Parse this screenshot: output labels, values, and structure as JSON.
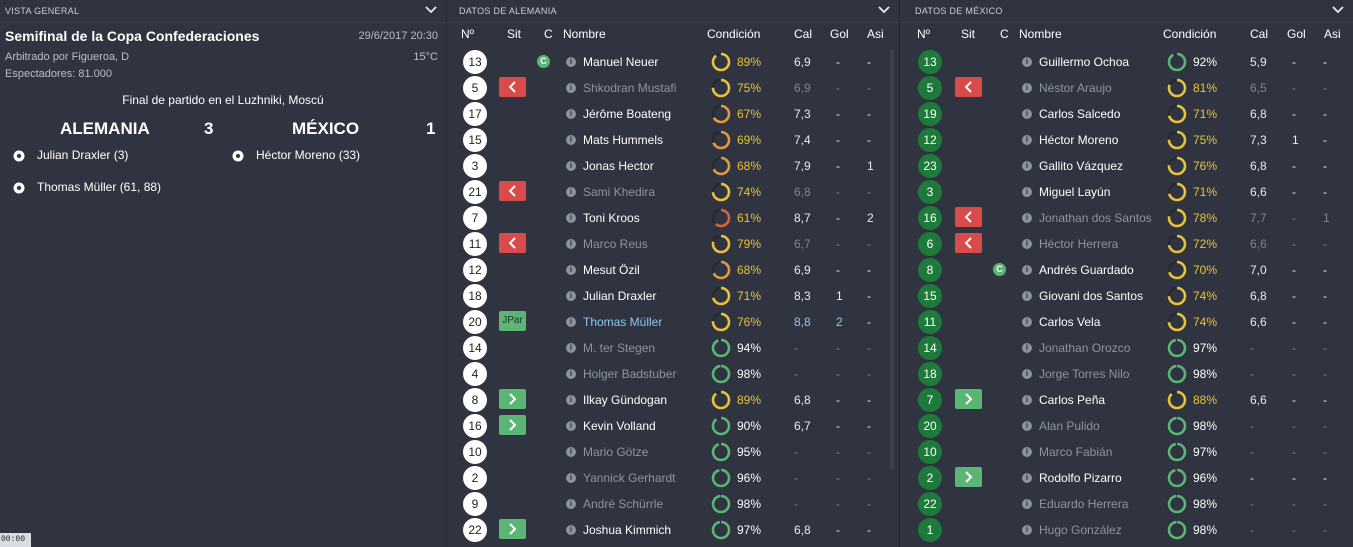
{
  "overview": {
    "header": "VISTA GENERAL",
    "title": "Semifinal de la Copa Confederaciones",
    "date": "29/6/2017 20:30",
    "referee": "Arbitrado por Figueroa, D",
    "temperature": "15°C",
    "attendance": "Espectadores: 81.000",
    "final_text": "Final de partido en el Luzhniki, Moscú",
    "home_team": "ALEMANIA",
    "home_score": "3",
    "away_team": "MÉXICO",
    "away_score": "1",
    "home_scorers": [
      "Julian Draxler (3)",
      "Thomas Müller (61, 88)"
    ],
    "away_scorers": [
      "Héctor Moreno (33)"
    ],
    "clock": "00:00"
  },
  "columns": {
    "num": "Nº",
    "sit": "Sit",
    "c": "C",
    "name": "Nombre",
    "cond": "Condición",
    "cal": "Cal",
    "gol": "Gol",
    "asi": "Asi"
  },
  "colors": {
    "cond_green": "#5bb574",
    "cond_yellow": "#e8c33a",
    "cond_orange": "#e49a3c",
    "cond_red": "#d9643a"
  },
  "germany": {
    "header": "DATOS DE ALEMANIA",
    "players": [
      {
        "num": "13",
        "sit": "",
        "captain": true,
        "name": "Manuel Neuer",
        "cond": 89,
        "cal": "6,9",
        "gol": "-",
        "asi": "-",
        "style": "normal"
      },
      {
        "num": "5",
        "sit": "out",
        "captain": false,
        "name": "Shkodran Mustafi",
        "cond": 75,
        "cal": "6,9",
        "gol": "-",
        "asi": "-",
        "style": "sub"
      },
      {
        "num": "17",
        "sit": "",
        "captain": false,
        "name": "Jérôme Boateng",
        "cond": 67,
        "cal": "7,3",
        "gol": "-",
        "asi": "-",
        "style": "normal"
      },
      {
        "num": "15",
        "sit": "",
        "captain": false,
        "name": "Mats Hummels",
        "cond": 69,
        "cal": "7,4",
        "gol": "-",
        "asi": "-",
        "style": "normal"
      },
      {
        "num": "3",
        "sit": "",
        "captain": false,
        "name": "Jonas Hector",
        "cond": 68,
        "cal": "7,9",
        "gol": "-",
        "asi": "1",
        "style": "normal"
      },
      {
        "num": "21",
        "sit": "out",
        "captain": false,
        "name": "Sami Khedira",
        "cond": 74,
        "cal": "6,8",
        "gol": "-",
        "asi": "-",
        "style": "sub"
      },
      {
        "num": "7",
        "sit": "",
        "captain": false,
        "name": "Toni Kroos",
        "cond": 61,
        "cal": "8,7",
        "gol": "-",
        "asi": "2",
        "style": "normal"
      },
      {
        "num": "11",
        "sit": "out",
        "captain": false,
        "name": "Marco Reus",
        "cond": 79,
        "cal": "6,7",
        "gol": "-",
        "asi": "-",
        "style": "sub"
      },
      {
        "num": "12",
        "sit": "",
        "captain": false,
        "name": "Mesut Özil",
        "cond": 68,
        "cal": "6,9",
        "gol": "-",
        "asi": "-",
        "style": "normal"
      },
      {
        "num": "18",
        "sit": "",
        "captain": false,
        "name": "Julian Draxler",
        "cond": 71,
        "cal": "8,3",
        "gol": "1",
        "asi": "-",
        "style": "normal"
      },
      {
        "num": "20",
        "sit": "jpar",
        "sit_label": "JPar",
        "captain": false,
        "name": "Thomas Müller",
        "cond": 76,
        "cal": "8,8",
        "gol": "2",
        "asi": "-",
        "style": "hl"
      },
      {
        "num": "14",
        "sit": "",
        "captain": false,
        "name": "M. ter Stegen",
        "cond": 94,
        "cal": "-",
        "gol": "-",
        "asi": "-",
        "style": "sub"
      },
      {
        "num": "4",
        "sit": "",
        "captain": false,
        "name": "Holger Badstuber",
        "cond": 98,
        "cal": "-",
        "gol": "-",
        "asi": "-",
        "style": "sub"
      },
      {
        "num": "8",
        "sit": "in",
        "captain": false,
        "name": "Ilkay Gündogan",
        "cond": 89,
        "cal": "6,8",
        "gol": "-",
        "asi": "-",
        "style": "normal"
      },
      {
        "num": "16",
        "sit": "in",
        "captain": false,
        "name": "Kevin Volland",
        "cond": 90,
        "cal": "6,7",
        "gol": "-",
        "asi": "-",
        "style": "normal"
      },
      {
        "num": "10",
        "sit": "",
        "captain": false,
        "name": "Mario Götze",
        "cond": 95,
        "cal": "-",
        "gol": "-",
        "asi": "-",
        "style": "sub"
      },
      {
        "num": "2",
        "sit": "",
        "captain": false,
        "name": "Yannick Gerhardt",
        "cond": 96,
        "cal": "-",
        "gol": "-",
        "asi": "-",
        "style": "sub"
      },
      {
        "num": "9",
        "sit": "",
        "captain": false,
        "name": "André Schürrle",
        "cond": 98,
        "cal": "-",
        "gol": "-",
        "asi": "-",
        "style": "sub"
      },
      {
        "num": "22",
        "sit": "in",
        "captain": false,
        "name": "Joshua Kimmich",
        "cond": 97,
        "cal": "6,8",
        "gol": "-",
        "asi": "-",
        "style": "normal"
      }
    ]
  },
  "mexico": {
    "header": "DATOS DE MÉXICO",
    "players": [
      {
        "num": "13",
        "sit": "",
        "captain": false,
        "name": "Guillermo Ochoa",
        "cond": 92,
        "cal": "5,9",
        "gol": "-",
        "asi": "-",
        "style": "normal"
      },
      {
        "num": "5",
        "sit": "out",
        "captain": false,
        "name": "Néstor Araujo",
        "cond": 81,
        "cal": "6,5",
        "gol": "-",
        "asi": "-",
        "style": "sub"
      },
      {
        "num": "19",
        "sit": "",
        "captain": false,
        "name": "Carlos Salcedo",
        "cond": 71,
        "cal": "6,8",
        "gol": "-",
        "asi": "-",
        "style": "normal"
      },
      {
        "num": "12",
        "sit": "",
        "captain": false,
        "name": "Héctor Moreno",
        "cond": 75,
        "cal": "7,3",
        "gol": "1",
        "asi": "-",
        "style": "normal"
      },
      {
        "num": "23",
        "sit": "",
        "captain": false,
        "name": "Gallito Vázquez",
        "cond": 76,
        "cal": "6,8",
        "gol": "-",
        "asi": "-",
        "style": "normal"
      },
      {
        "num": "3",
        "sit": "",
        "captain": false,
        "name": "Miguel Layún",
        "cond": 71,
        "cal": "6,6",
        "gol": "-",
        "asi": "-",
        "style": "normal"
      },
      {
        "num": "16",
        "sit": "out",
        "captain": false,
        "name": "Jonathan dos Santos",
        "cond": 78,
        "cal": "7,7",
        "gol": "-",
        "asi": "1",
        "style": "sub"
      },
      {
        "num": "6",
        "sit": "out",
        "captain": false,
        "name": "Héctor Herrera",
        "cond": 72,
        "cal": "6,6",
        "gol": "-",
        "asi": "-",
        "style": "sub"
      },
      {
        "num": "8",
        "sit": "",
        "captain": true,
        "name": "Andrés Guardado",
        "cond": 70,
        "cal": "7,0",
        "gol": "-",
        "asi": "-",
        "style": "normal"
      },
      {
        "num": "15",
        "sit": "",
        "captain": false,
        "name": "Giovani dos Santos",
        "cond": 74,
        "cal": "6,8",
        "gol": "-",
        "asi": "-",
        "style": "normal"
      },
      {
        "num": "11",
        "sit": "",
        "captain": false,
        "name": "Carlos Vela",
        "cond": 74,
        "cal": "6,6",
        "gol": "-",
        "asi": "-",
        "style": "normal"
      },
      {
        "num": "14",
        "sit": "",
        "captain": false,
        "name": "Jonathan Orozco",
        "cond": 97,
        "cal": "-",
        "gol": "-",
        "asi": "-",
        "style": "sub"
      },
      {
        "num": "18",
        "sit": "",
        "captain": false,
        "name": "Jorge Torres Nilo",
        "cond": 98,
        "cal": "-",
        "gol": "-",
        "asi": "-",
        "style": "sub"
      },
      {
        "num": "7",
        "sit": "in",
        "captain": false,
        "name": "Carlos Peña",
        "cond": 88,
        "cal": "6,6",
        "gol": "-",
        "asi": "-",
        "style": "normal"
      },
      {
        "num": "20",
        "sit": "",
        "captain": false,
        "name": "Alan Pulido",
        "cond": 98,
        "cal": "-",
        "gol": "-",
        "asi": "-",
        "style": "sub"
      },
      {
        "num": "10",
        "sit": "",
        "captain": false,
        "name": "Marco Fabián",
        "cond": 97,
        "cal": "-",
        "gol": "-",
        "asi": "-",
        "style": "sub"
      },
      {
        "num": "2",
        "sit": "in",
        "captain": false,
        "name": "Rodolfo Pizarro",
        "cond": 96,
        "cal": "-",
        "gol": "-",
        "asi": "-",
        "style": "normal"
      },
      {
        "num": "22",
        "sit": "",
        "captain": false,
        "name": "Eduardo Herrera",
        "cond": 98,
        "cal": "-",
        "gol": "-",
        "asi": "-",
        "style": "sub"
      },
      {
        "num": "1",
        "sit": "",
        "captain": false,
        "name": "Hugo González",
        "cond": 98,
        "cal": "-",
        "gol": "-",
        "asi": "-",
        "style": "sub"
      }
    ]
  },
  "icons": {
    "captain": "C",
    "info": "i",
    "sub_out": "chevron-left-icon",
    "sub_in": "chevron-right-icon",
    "goal": "football-icon",
    "collapse": "chevron-down-icon"
  }
}
